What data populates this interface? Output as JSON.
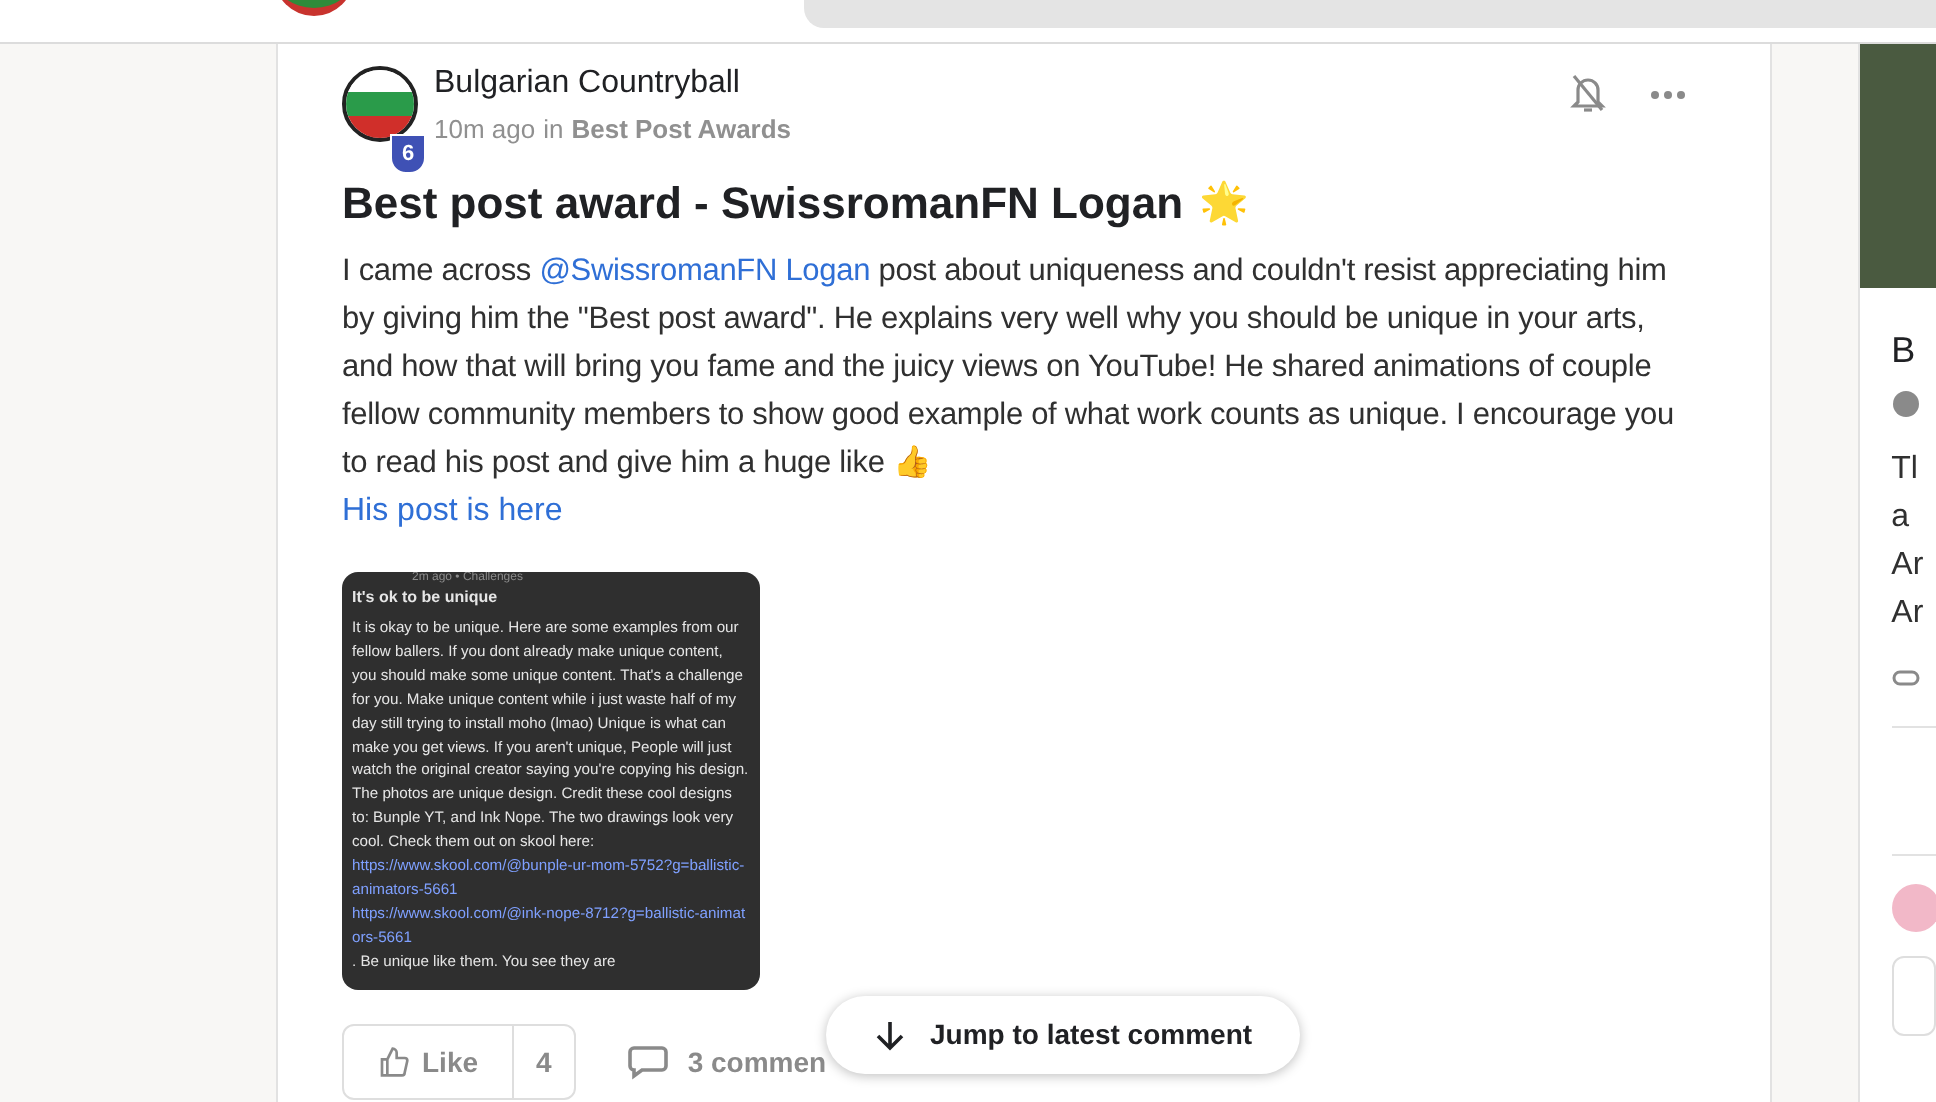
{
  "post": {
    "author": "Bulgarian Countryball",
    "level": "6",
    "time": "10m ago",
    "in_word": "in",
    "category": "Best Post Awards",
    "title": "Best post award - SwissromanFN Logan",
    "title_emoji": "🌟",
    "body_before": "I came across ",
    "mention": "@SwissromanFN Logan",
    "body_after": " post about uniqueness and couldn't resist appreciating him by giving him the \"Best post award\". He explains very well why you should be unique in your arts, and how that will bring you fame and the juicy views on YouTube! He shared animations of couple fellow community members to show good example of what work counts as unique. I encourage you to read his post and give him a huge like 👍",
    "link": "His post is here",
    "attachment": {
      "meta": "2m ago • Challenges",
      "title": "It's ok to be unique",
      "body": "It is okay to be unique. Here are some examples from our fellow ballers. If you dont already make unique content, you should make some unique content. That's a challenge for you. Make unique content while i just waste half of my day still trying to install moho (lmao) Unique is what can make you get views. If you aren't unique, People will just watch the original creator saying you're copying his design. The photos are unique design. Credit these cool designs to: Bunple YT, and Ink Nope. The two drawings look very cool. Check them out on skool here:",
      "link_1": "https://www.skool.com/@bunple-ur-mom-5752?g=ballistic-animators-5661",
      "link_2": "https://www.skool.com/@ink-nope-8712?g=ballistic-animators-5661",
      "tail": ". Be unique like them. You see they are"
    },
    "like_label": "Like",
    "like_count": "4",
    "comments": "3 commen"
  },
  "jump_button": "Jump to latest comment",
  "side_card": {
    "title": "B",
    "lines": [
      "Tl",
      "a",
      "Ar",
      "Ar"
    ]
  }
}
